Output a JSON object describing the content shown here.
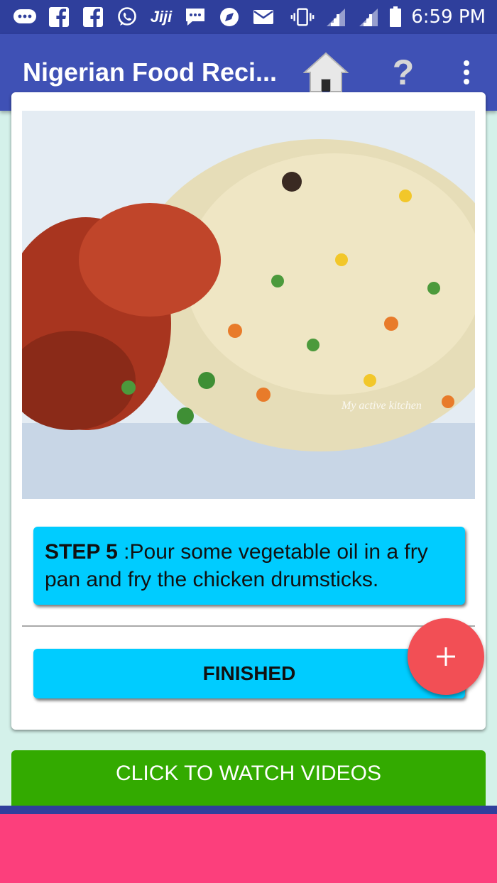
{
  "status_bar": {
    "time": "6:59 PM",
    "notification_icons": [
      "messages-icon",
      "facebook-icon",
      "facebook-icon",
      "whatsapp-icon",
      "jiji-icon",
      "chat-icon",
      "browser-icon",
      "email-icon"
    ],
    "jiji_label": "Jiji",
    "status_icons": [
      "vibrate-icon",
      "signal-icon",
      "signal-icon",
      "battery-icon"
    ]
  },
  "app_bar": {
    "title": "Nigerian Food Reci...",
    "help_label": "?",
    "icons": [
      "home-icon",
      "help-icon",
      "more-vert-icon"
    ]
  },
  "recipe": {
    "image_alt": "Fried rice with chicken drumstick",
    "image_watermark": "My active kitchen",
    "step_label": "STEP 5",
    "step_text": " :Pour some vegetable oil in a fry pan and fry the chicken drumsticks.",
    "finished_label": "FINISHED"
  },
  "fab": {
    "label": "+"
  },
  "watch_videos_label": "CLICK TO WATCH VIDEOS",
  "colors": {
    "primary": "#3f51b5",
    "status_bar": "#2f3f9c",
    "accent_cyan": "#00ccff",
    "fab": "#f24f55",
    "watch_button": "#33aa00",
    "ad_banner": "#fc3f7c",
    "background": "#d4f1ea"
  }
}
